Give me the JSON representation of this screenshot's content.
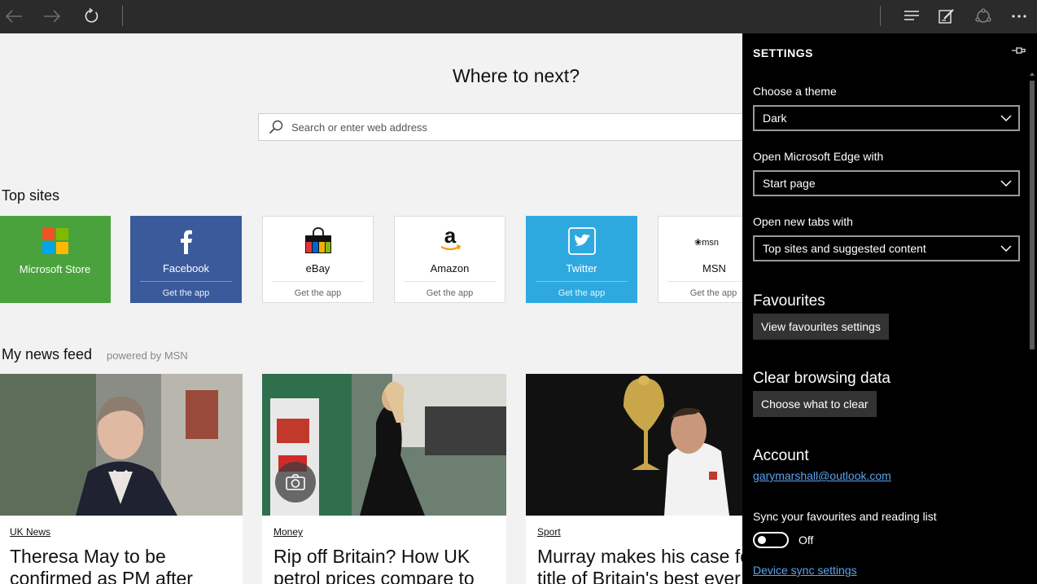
{
  "toolbar": {
    "back_icon": "back-arrow-icon",
    "forward_icon": "forward-arrow-icon",
    "refresh_icon": "refresh-icon",
    "hub_icon": "hub-icon",
    "note_icon": "web-note-icon",
    "share_icon": "share-icon",
    "more_icon": "more-icon"
  },
  "start": {
    "headline": "Where to next?",
    "search_placeholder": "Search or enter web address",
    "top_sites_title": "Top sites",
    "tiles": [
      {
        "name": "Microsoft Store",
        "sub": ""
      },
      {
        "name": "Facebook",
        "sub": "Get the app"
      },
      {
        "name": "eBay",
        "sub": "Get the app"
      },
      {
        "name": "Amazon",
        "sub": "Get the app"
      },
      {
        "name": "Twitter",
        "sub": "Get the app"
      },
      {
        "name": "MSN",
        "sub": "Get the app",
        "logo_text": "msn"
      }
    ],
    "news_title": "My news feed",
    "powered_by": "powered by MSN",
    "news": [
      {
        "category": "UK News",
        "title": "Theresa May to be confirmed as PM after"
      },
      {
        "category": "Money",
        "title": "Rip off Britain? How UK petrol prices compare to"
      },
      {
        "category": "Sport",
        "title": "Murray makes his case for title of Britain's best ever"
      }
    ]
  },
  "settings": {
    "title": "SETTINGS",
    "theme_label": "Choose a theme",
    "theme_value": "Dark",
    "open_with_label": "Open Microsoft Edge with",
    "open_with_value": "Start page",
    "new_tabs_label": "Open new tabs with",
    "new_tabs_value": "Top sites and suggested content",
    "favourites_heading": "Favourites",
    "favourites_button": "View favourites settings",
    "clear_heading": "Clear browsing data",
    "clear_button": "Choose what to clear",
    "account_heading": "Account",
    "account_email": "garymarshall@outlook.com",
    "sync_label": "Sync your favourites and reading list",
    "sync_state": "Off",
    "device_sync_link": "Device sync settings"
  },
  "colors": {
    "toolbar_bg": "#2b2b2b",
    "settings_bg": "#000000",
    "link": "#5aa3f0",
    "store_green": "#4aa23d",
    "facebook_blue": "#3b5a9c",
    "twitter_blue": "#2ea9e0"
  }
}
